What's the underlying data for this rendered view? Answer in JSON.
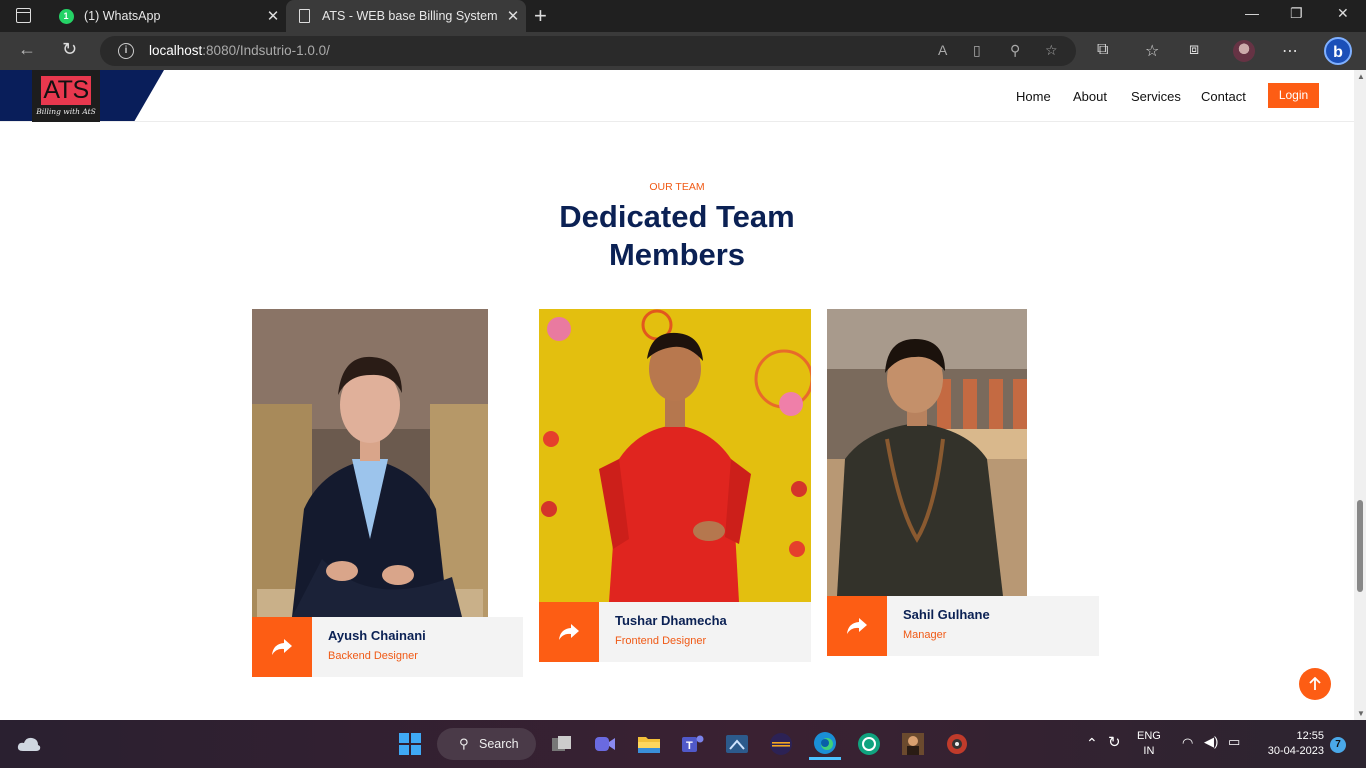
{
  "browser": {
    "tabs": [
      {
        "title": "(1) WhatsApp",
        "badge": "1"
      },
      {
        "title": "ATS - WEB base Billing System"
      }
    ],
    "url_host": "localhost",
    "url_rest": ":8080/Indsutrio-1.0.0/"
  },
  "site": {
    "logo_text": "ATS",
    "logo_tagline": "Billing with AtS",
    "nav": [
      "Home",
      "About",
      "Services",
      "Contact"
    ],
    "login_label": "Login",
    "accent": "#fd5d14",
    "navy": "#0b2154"
  },
  "team": {
    "subtitle": "OUR TEAM",
    "title": "Dedicated Team Members",
    "members": [
      {
        "name": "Ayush Chainani",
        "role": "Backend Designer"
      },
      {
        "name": "Tushar Dhamecha",
        "role": "Frontend Designer"
      },
      {
        "name": "Sahil Gulhane",
        "role": "Manager"
      }
    ]
  },
  "taskbar": {
    "search_label": "Search",
    "lang": "ENG",
    "region": "IN",
    "time": "12:55",
    "date": "30-04-2023",
    "notifications": "7"
  }
}
